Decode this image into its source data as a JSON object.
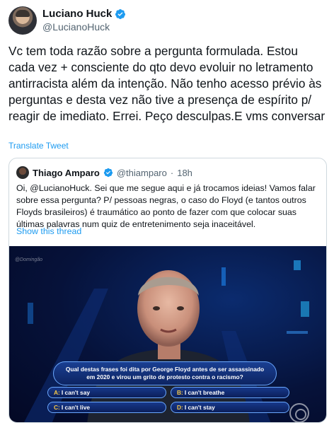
{
  "author": {
    "name": "Luciano Huck",
    "handle": "@LucianoHuck",
    "verified_icon": "verified-badge-icon"
  },
  "tweet": {
    "text": "Vc tem toda razão sobre a pergunta formulada. Estou cada vez + consciente do qto devo evoluir no letramento antirracista além da intenção. Não tenho acesso prévio às perguntas e desta vez não tive a presença de espírito p/ reagir de imediato. Errei. Peço desculpas.E vms conversar",
    "translate_label": "Translate Tweet"
  },
  "quoted": {
    "name": "Thiago Amparo",
    "handle": "@thiamparo",
    "separator": "·",
    "time": "18h",
    "text": "Oi, @LucianoHuck. Sei que me segue aqui e já trocamos ideias! Vamos falar sobre essa pergunta? P/ pessoas negras, o caso do Floyd (e tantos outros Floyds brasileiros) é traumático ao ponto de fazer com que colocar suas últimas palavras num quiz de entretenimento seja inaceitável.",
    "show_thread_label": "Show this thread",
    "image": {
      "watermark": "@Domingão",
      "question_line1": "Qual destas frases foi dita por George Floyd antes de ser assassinado",
      "question_line2": "em 2020 e virou um grito de protesto contra o racismo?",
      "answers": [
        {
          "letter": "A:",
          "text": "I can't say"
        },
        {
          "letter": "B:",
          "text": "I can't breathe"
        },
        {
          "letter": "C:",
          "text": "I can't live"
        },
        {
          "letter": "D:",
          "text": "I can't stay"
        }
      ]
    }
  },
  "colors": {
    "link": "#1d9bf0",
    "secondary_text": "#536471",
    "border": "#cfd9de",
    "answer_letter": "#f7c948"
  }
}
